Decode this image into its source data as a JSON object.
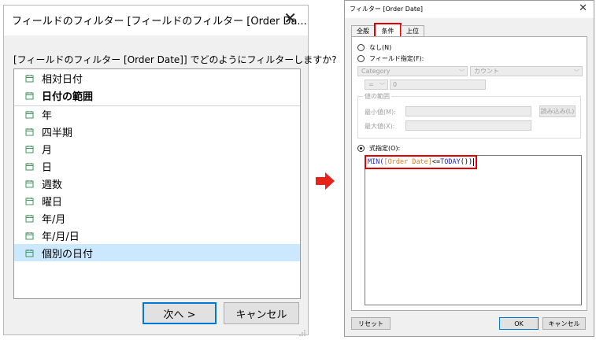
{
  "left_dialog": {
    "title": "フィールドのフィルター [フィールドのフィルター [Order Da...",
    "question": "[フィールドのフィルター [Order Date]] でどのようにフィルターしますか?",
    "items": [
      {
        "label": "相対日付"
      },
      {
        "label": "日付の範囲"
      },
      {
        "label": "年"
      },
      {
        "label": "四半期"
      },
      {
        "label": "月"
      },
      {
        "label": "日"
      },
      {
        "label": "週数"
      },
      {
        "label": "曜日"
      },
      {
        "label": "年/月"
      },
      {
        "label": "年/月/日"
      },
      {
        "label": "個別の日付"
      }
    ],
    "selected_item": "個別の日付",
    "next_label": "次へ >",
    "cancel_label": "キャンセル"
  },
  "right_dialog": {
    "title": "フィルター [Order Date]",
    "tabs": [
      {
        "label": "全般"
      },
      {
        "label": "条件"
      },
      {
        "label": "上位"
      }
    ],
    "active_tab": "条件",
    "none_label": "なし(N)",
    "field_label": "フィールド指定(F):",
    "field_combo": "Category",
    "agg_combo": "カウント",
    "operator_combo": "=",
    "value_input": "0",
    "range_legend": "値の範囲",
    "min_label": "最小値(M):",
    "max_label": "最大値(X):",
    "load_button": "読み込み(L)",
    "formula_label": "式指定(O):",
    "formula": {
      "fn": "MIN(",
      "field": "[Order Date]",
      "op": "<=",
      "fn2": "TODAY",
      "rest": "())"
    },
    "reset_label": "リセット",
    "ok_label": "OK",
    "cancel_label": "キャンセル"
  },
  "colors": {
    "selection": "#cce8ff",
    "highlight_red": "#e00000",
    "accent_blue": "#0078d7",
    "formula_fn": "#1f1fd4",
    "formula_field": "#e07c2b"
  }
}
